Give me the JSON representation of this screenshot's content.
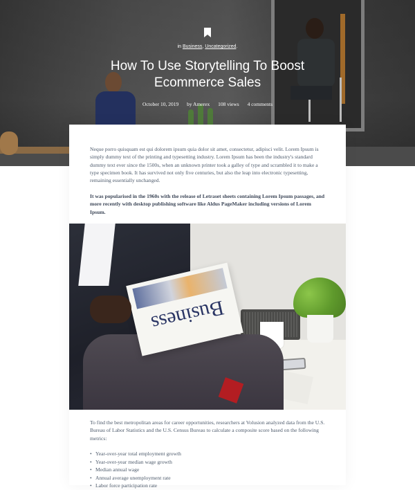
{
  "hero": {
    "category_prefix": "in",
    "categories": [
      "Business",
      "Uncategorized"
    ],
    "category_separator": ",",
    "category_suffix": ".",
    "title_line1": "How To Use Storytelling To Boost",
    "title_line2": "Ecommerce Sales",
    "meta": {
      "date": "October 10, 2019",
      "author": "by Amerex",
      "views": "108 views",
      "comments": "4 comments"
    }
  },
  "article": {
    "intro": "Neque porro quisquam est qui dolorem ipsum quia dolor sit amet, consectetur, adipisci velit. Lorem Ipsum is simply dummy text of the printing and typesetting industry. Lorem Ipsum has been the industry's standard dummy text ever since the 1500s, when an unknown printer took a galley of type and scrambled it to make a type specimen book. It has survived not only five centuries, but also the leap into electronic typesetting, remaining essentially unchanged.",
    "highlight": "It was popularised in the 1960s with the release of Letraset sheets containing Lorem Ipsum passages, and more recently with desktop publishing software like Aldus PageMaker including versions of Lorem Ipsum.",
    "image_newspaper_text": "Business",
    "body": "To find the best metropolitan areas for career opportunities, researchers at Volusion analyzed data from the U.S. Bureau of Labor Statistics and the U.S. Census Bureau to calculate a composite score based on the following metrics:",
    "metrics": [
      "Year-over-year total employment growth",
      "Year-over-year median wage growth",
      "Median annual wage",
      "Annual average unemployment rate",
      "Labor force participation rate"
    ]
  },
  "colors": {
    "text": "#4d5a6b",
    "hero_text": "#ffffff",
    "background": "#ffffff"
  },
  "icons": {
    "bookmark": "bookmark-icon"
  }
}
